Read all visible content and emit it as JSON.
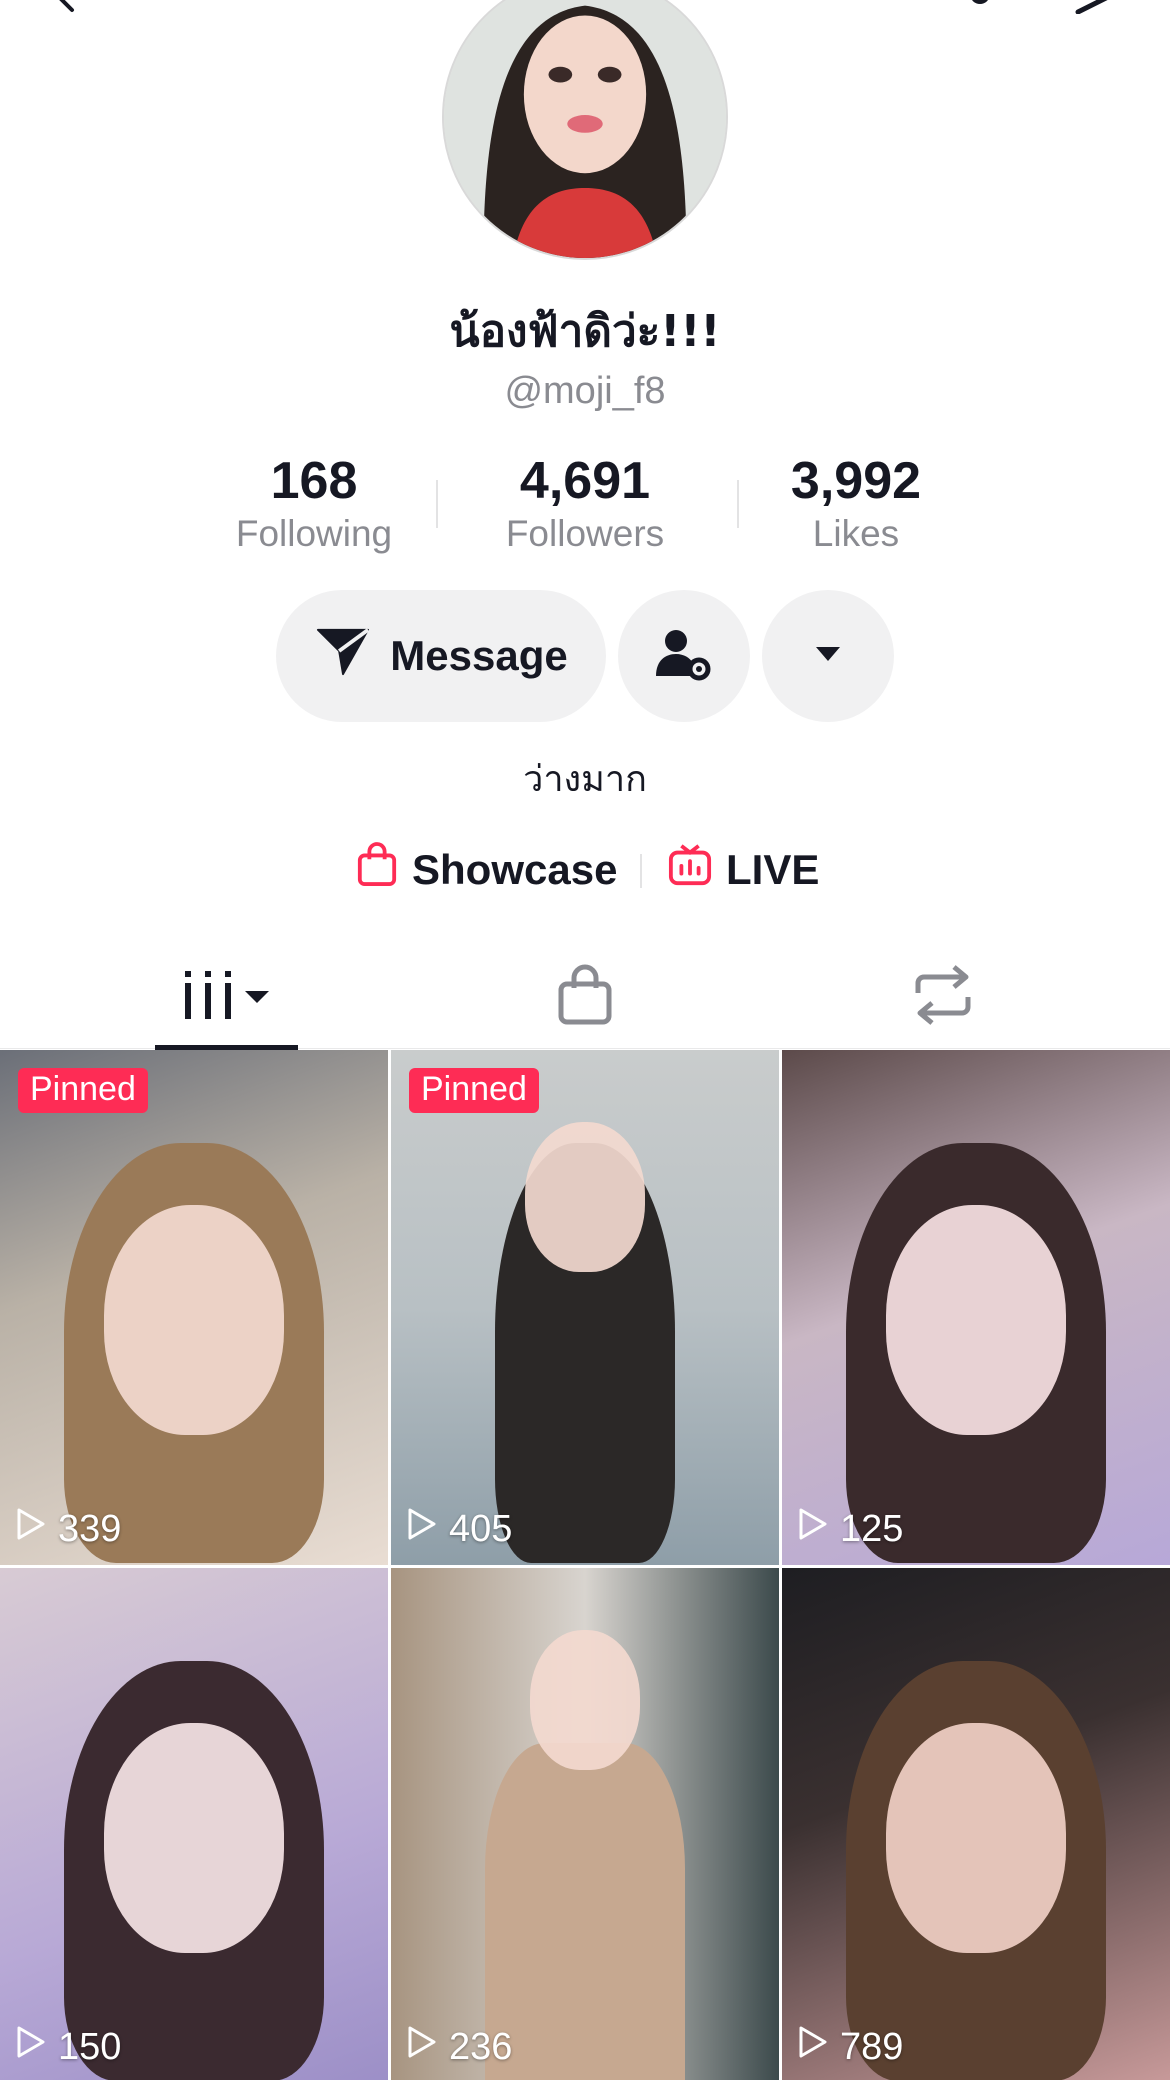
{
  "profile": {
    "display_name": "น้องฟ้าดิว่ะ!!!",
    "username": "@moji_f8",
    "bio": "ว่างมาก"
  },
  "stats": [
    {
      "value": "168",
      "label": "Following"
    },
    {
      "value": "4,691",
      "label": "Followers"
    },
    {
      "value": "3,992",
      "label": "Likes"
    }
  ],
  "actions": {
    "message_label": "Message"
  },
  "links": {
    "showcase_label": "Showcase",
    "live_label": "LIVE"
  },
  "tabs": {
    "active": "videos",
    "items": [
      "videos",
      "shop",
      "reposts"
    ]
  },
  "videos": [
    {
      "pinned": "Pinned",
      "views": "339"
    },
    {
      "pinned": "Pinned",
      "views": "405"
    },
    {
      "pinned": "",
      "views": "125"
    },
    {
      "pinned": "",
      "views": "150"
    },
    {
      "pinned": "",
      "views": "236"
    },
    {
      "pinned": "",
      "views": "789"
    }
  ],
  "colors": {
    "accent": "#fe2c55",
    "text": "#161823",
    "muted": "#8a8b91",
    "button_bg": "#f1f1f2"
  }
}
